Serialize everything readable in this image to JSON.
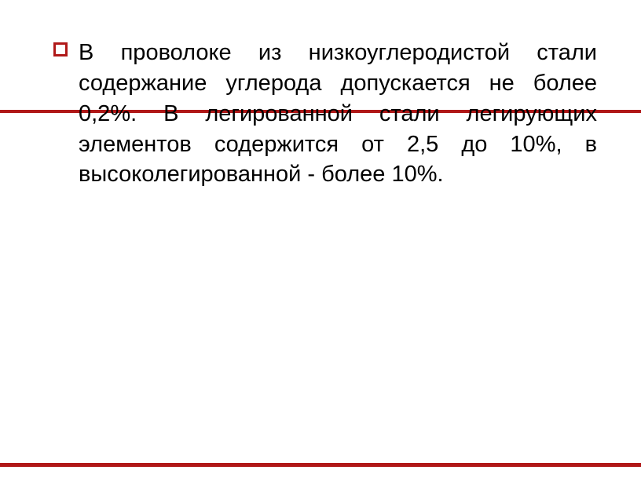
{
  "slide": {
    "bullet_icon": "square-outline",
    "text": "В проволоке из низкоуглеродистой стали содержание углерода допускается не более 0,2%. В легированной стали легирующих элементов содержится от 2,5 до 10%, в высоколегированной - более 10%.",
    "accent_color": "#b01818"
  }
}
